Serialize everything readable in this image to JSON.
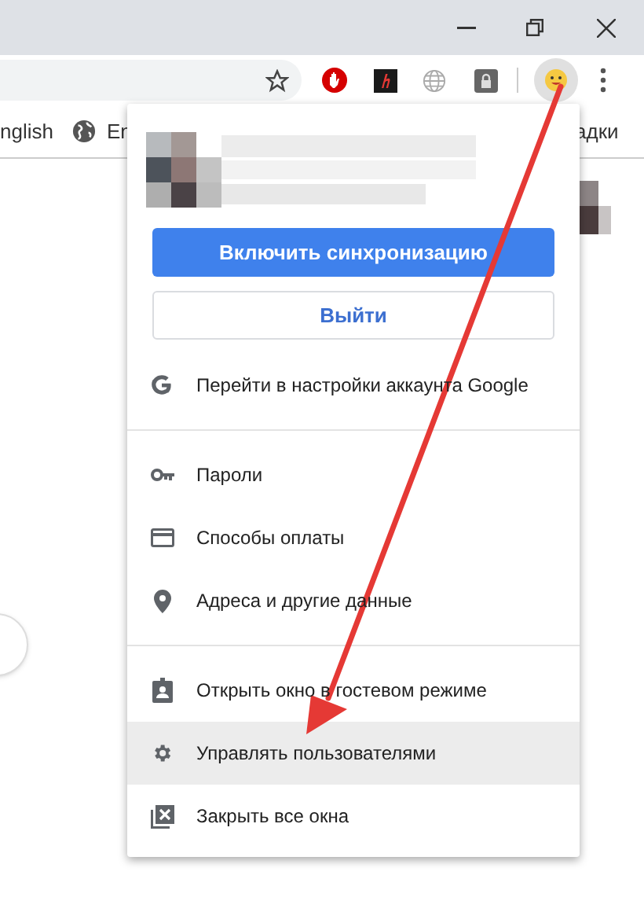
{
  "bookmarks": [
    {
      "label": "nglish",
      "kind": "text"
    },
    {
      "label": "En",
      "kind": "globe"
    },
    {
      "label": "адки",
      "kind": "text"
    }
  ],
  "profile_menu": {
    "sync_button": "Включить синхронизацию",
    "signout_button": "Выйти",
    "sections": [
      [
        {
          "kind": "google",
          "label": "Перейти в настройки аккаунта Google",
          "selected": false
        }
      ],
      [
        {
          "kind": "key",
          "label": "Пароли",
          "selected": false
        },
        {
          "kind": "card",
          "label": "Способы оплаты",
          "selected": false
        },
        {
          "kind": "pin",
          "label": "Адреса и другие данные",
          "selected": false
        }
      ],
      [
        {
          "kind": "guest",
          "label": "Открыть окно в гостевом режиме",
          "selected": false
        },
        {
          "kind": "gear",
          "label": "Управлять пользователями",
          "selected": true
        },
        {
          "kind": "close",
          "label": "Закрыть все окна",
          "selected": false
        }
      ]
    ]
  }
}
